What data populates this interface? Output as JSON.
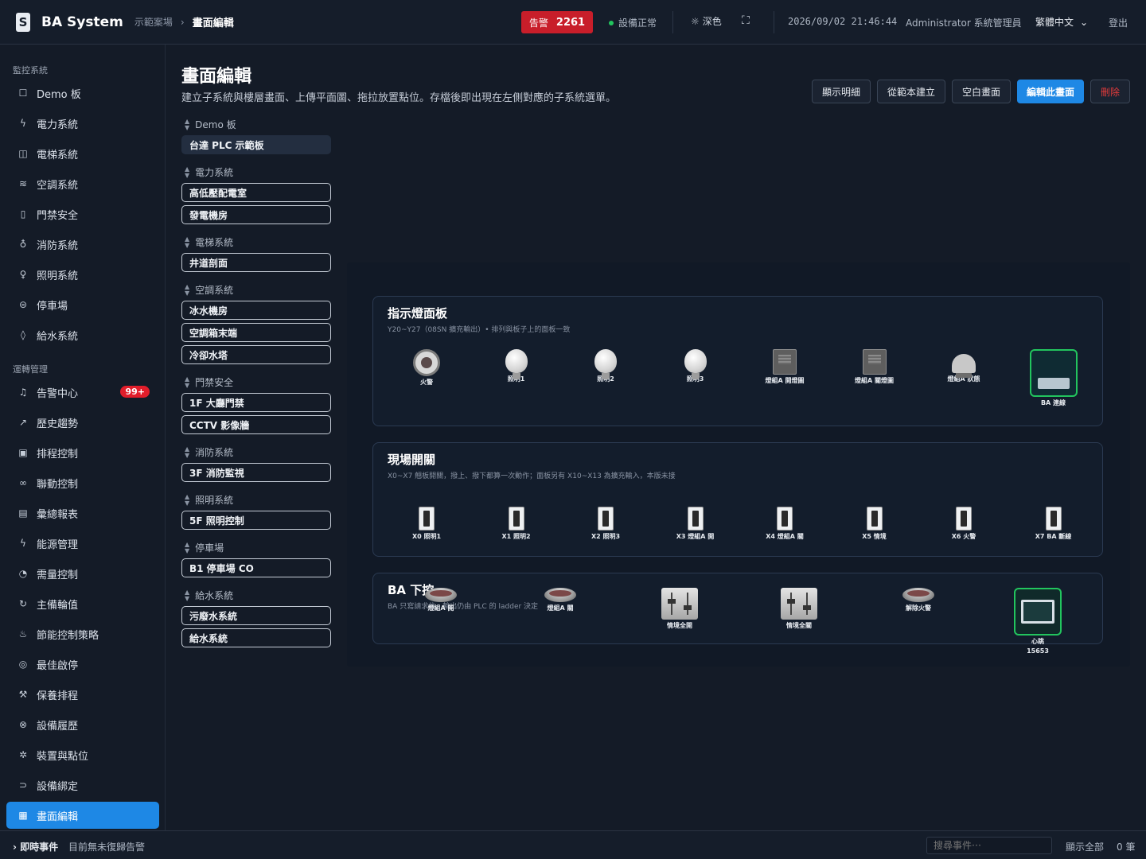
{
  "header": {
    "brand": "BA System",
    "breadcrumb_site": "示範案場",
    "breadcrumb_page": "畫面編輯",
    "alarm_label": "告警",
    "alarm_count": "2261",
    "status_text": "設備正常",
    "theme_label": "深色",
    "datetime": "2026/09/02 21:46:44",
    "user": "Administrator 系統管理員",
    "language": "繁體中文",
    "logout": "登出",
    "logo_letter": "S"
  },
  "sidebar": {
    "section_monitor": "監控系統",
    "monitor_items": [
      {
        "label": "Demo 板",
        "icon": "square-icon"
      },
      {
        "label": "電力系統",
        "icon": "bolt-icon"
      },
      {
        "label": "電梯系統",
        "icon": "elevator-icon"
      },
      {
        "label": "空調系統",
        "icon": "wind-icon"
      },
      {
        "label": "門禁安全",
        "icon": "door-icon"
      },
      {
        "label": "消防系統",
        "icon": "flame-icon"
      },
      {
        "label": "照明系統",
        "icon": "bulb-icon"
      },
      {
        "label": "停車場",
        "icon": "car-icon"
      },
      {
        "label": "給水系統",
        "icon": "droplet-icon"
      }
    ],
    "section_ops": "運轉管理",
    "ops_items": [
      {
        "label": "告警中心",
        "icon": "bell-icon",
        "badge": "99+"
      },
      {
        "label": "歷史趨勢",
        "icon": "chart-icon"
      },
      {
        "label": "排程控制",
        "icon": "calendar-icon"
      },
      {
        "label": "聯動控制",
        "icon": "link-icon"
      },
      {
        "label": "彙總報表",
        "icon": "report-icon"
      },
      {
        "label": "能源管理",
        "icon": "energy-icon"
      },
      {
        "label": "需量控制",
        "icon": "gauge-icon"
      },
      {
        "label": "主備輪值",
        "icon": "cycle-icon"
      },
      {
        "label": "節能控制策略",
        "icon": "thermo-icon"
      },
      {
        "label": "最佳啟停",
        "icon": "optimize-icon"
      },
      {
        "label": "保養排程",
        "icon": "wrench-icon"
      },
      {
        "label": "設備履歷",
        "icon": "history-icon"
      },
      {
        "label": "裝置與點位",
        "icon": "cog-icon"
      },
      {
        "label": "設備綁定",
        "icon": "bind-icon"
      },
      {
        "label": "畫面編輯",
        "icon": "layout-icon"
      }
    ]
  },
  "main": {
    "title": "畫面編輯",
    "subtitle": "建立子系統與樓層畫面、上傳平面圖、拖拉放置點位。存檔後即出現在左側對應的子系統選單。",
    "buttons": {
      "show_detail": "顯示明細",
      "from_template": "從範本建立",
      "blank": "空白畫面",
      "edit": "編輯此畫面",
      "delete": "刪除"
    }
  },
  "page_groups": [
    {
      "name": "Demo 板",
      "pages": [
        "台達 PLC 示範板"
      ]
    },
    {
      "name": "電力系統",
      "pages": [
        "高低壓配電室",
        "發電機房"
      ]
    },
    {
      "name": "電梯系統",
      "pages": [
        "井道剖面"
      ]
    },
    {
      "name": "空調系統",
      "pages": [
        "冰水機房",
        "空調箱末端",
        "冷卻水塔"
      ]
    },
    {
      "name": "門禁安全",
      "pages": [
        "1F 大廳門禁",
        "CCTV 影像牆"
      ]
    },
    {
      "name": "消防系統",
      "pages": [
        "3F 消防監視"
      ]
    },
    {
      "name": "照明系統",
      "pages": [
        "5F 照明控制"
      ]
    },
    {
      "name": "停車場",
      "pages": [
        "B1 停車場 CO"
      ]
    },
    {
      "name": "給水系統",
      "pages": [
        "污廢水系統",
        "給水系統"
      ]
    }
  ],
  "canvas": {
    "panel1": {
      "title": "指示燈面板",
      "subtitle": "Y20~Y27（08SN 擴充輸出）• 排列與板子上的面板一致",
      "items": [
        {
          "label": "火警",
          "type": "siren"
        },
        {
          "label": "照明1",
          "type": "bulb"
        },
        {
          "label": "照明2",
          "type": "bulb"
        },
        {
          "label": "照明3",
          "type": "bulb"
        },
        {
          "label": "燈組A 開燈圖",
          "type": "relay"
        },
        {
          "label": "燈組A 關燈圖",
          "type": "relay"
        },
        {
          "label": "燈組A 狀態",
          "type": "strobe"
        },
        {
          "label": "BA 連線",
          "type": "wifi"
        }
      ]
    },
    "panel2": {
      "title": "現場開關",
      "subtitle": "X0~X7 翹板開關，撥上、撥下都算一次動作；面板另有 X10~X13 為擴充輸入，本版未接",
      "items": [
        {
          "label": "X0 照明1"
        },
        {
          "label": "X1 照明2"
        },
        {
          "label": "X2 照明3"
        },
        {
          "label": "X3 燈組A 開"
        },
        {
          "label": "X4 燈組A 關"
        },
        {
          "label": "X5 情境"
        },
        {
          "label": "X6 火警"
        },
        {
          "label": "X7 BA 斷線"
        }
      ]
    },
    "panel3": {
      "title": "BA 下控",
      "subtitle": "BA 只寫請求位，輸出仍由 PLC 的 ladder 決定",
      "items": [
        {
          "label": "燈組A 開",
          "type": "button"
        },
        {
          "label": "燈組A 關",
          "type": "button"
        },
        {
          "label": "情境全開",
          "type": "mixer"
        },
        {
          "label": "情境全關",
          "type": "mixer"
        },
        {
          "label": "解除火警",
          "type": "button"
        },
        {
          "label": "心跳",
          "type": "monitor",
          "value": "15653"
        }
      ]
    }
  },
  "events": {
    "label": "即時事件",
    "status": "目前無未復歸告警",
    "search_placeholder": "搜尋事件⋯",
    "show_all": "顯示全部",
    "count": "0 筆"
  }
}
